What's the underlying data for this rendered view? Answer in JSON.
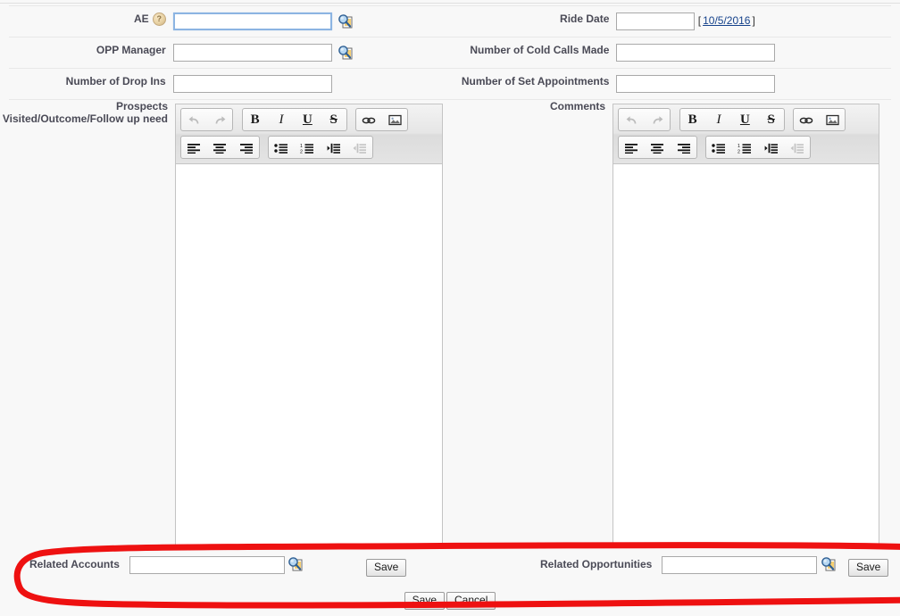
{
  "form": {
    "fields": [
      {
        "id": "ae",
        "label": "AE",
        "value": "",
        "help_icon": "?",
        "lookup_icon": "lookup-icon",
        "focused": true
      },
      {
        "id": "ride-date",
        "label": "Ride Date",
        "value": "",
        "hint_open": "[",
        "hint_link": "10/5/2016",
        "hint_close": "]"
      },
      {
        "id": "opp-manager",
        "label": "OPP Manager",
        "value": "",
        "lookup_icon": "lookup-icon"
      },
      {
        "id": "cold-calls",
        "label": "Number of Cold Calls Made",
        "value": ""
      },
      {
        "id": "drop-ins",
        "label": "Number of Drop Ins",
        "value": ""
      },
      {
        "id": "set-appointments",
        "label": "Number of Set Appointments",
        "value": ""
      }
    ],
    "rich_text": {
      "prospects": {
        "label": "Prospects Visited/Outcome/Follow up need",
        "value": ""
      },
      "comments": {
        "label": "Comments",
        "value": ""
      }
    },
    "toolbar": {
      "undo": "undo-icon",
      "redo": "redo-icon",
      "bold": "B",
      "italic": "I",
      "underline": "U",
      "strikethrough": "S",
      "link": "link-icon",
      "image": "image-icon",
      "align_left": "align-left-icon",
      "align_center": "align-center-icon",
      "align_right": "align-right-icon",
      "bullet_list": "bullet-list-icon",
      "numbered_list": "numbered-list-icon",
      "indent": "indent-icon",
      "outdent": "outdent-icon"
    }
  },
  "related": {
    "accounts": {
      "label": "Related Accounts",
      "value": "",
      "save_label": "Save",
      "lookup_icon": "lookup-icon"
    },
    "opportunities": {
      "label": "Related Opportunities",
      "value": "",
      "save_label": "Save",
      "lookup_icon": "lookup-icon"
    }
  },
  "footer": {
    "save_label": "Save",
    "cancel_label": "Cancel"
  },
  "annotation": {
    "color": "#ee1111",
    "shape": "ellipse-highlight"
  },
  "colors": {
    "label_text": "#4a4a56",
    "link": "#15428b",
    "page_background": "#f8f8f8",
    "input_border": "#a9a9a9",
    "focus_border": "#8cb4e2"
  }
}
